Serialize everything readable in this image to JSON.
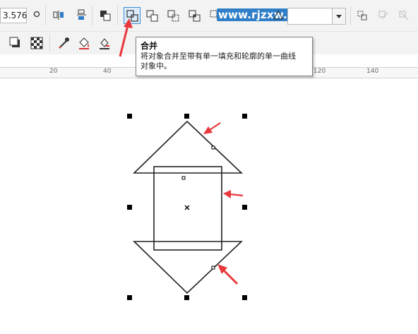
{
  "toolbar": {
    "size_value": "3.576",
    "outline_select_value": "",
    "website_watermark": "www.rjzxw.com"
  },
  "tooltip": {
    "title": "合并",
    "description_line1": "将对象合并至带有单一填充和轮廓的单一曲线",
    "description_line2": "对象中。"
  },
  "ruler": {
    "labels": [
      "20",
      "40",
      "120",
      "140"
    ]
  },
  "colors": {
    "toolbar_bg": "#f3f3f3",
    "active_button_border": "#3c8fd8",
    "annotation_arrow": "#e8383c",
    "watermark_bg": "#2f7ec8"
  },
  "icons": [
    "circle-icon",
    "flip-horizontal-icon",
    "flip-vertical-icon",
    "arrange-icon",
    "combine-icon",
    "weld-icon",
    "trim-icon",
    "intersect-icon",
    "simplify-icon",
    "front-minus-back-icon",
    "back-minus-front-icon",
    "boundary-icon",
    "break-apart-icon",
    "lock-icon",
    "unlock-icon",
    "shadow-icon",
    "transparency-icon",
    "eyedropper-icon",
    "fill-icon",
    "outline-fill-icon"
  ]
}
